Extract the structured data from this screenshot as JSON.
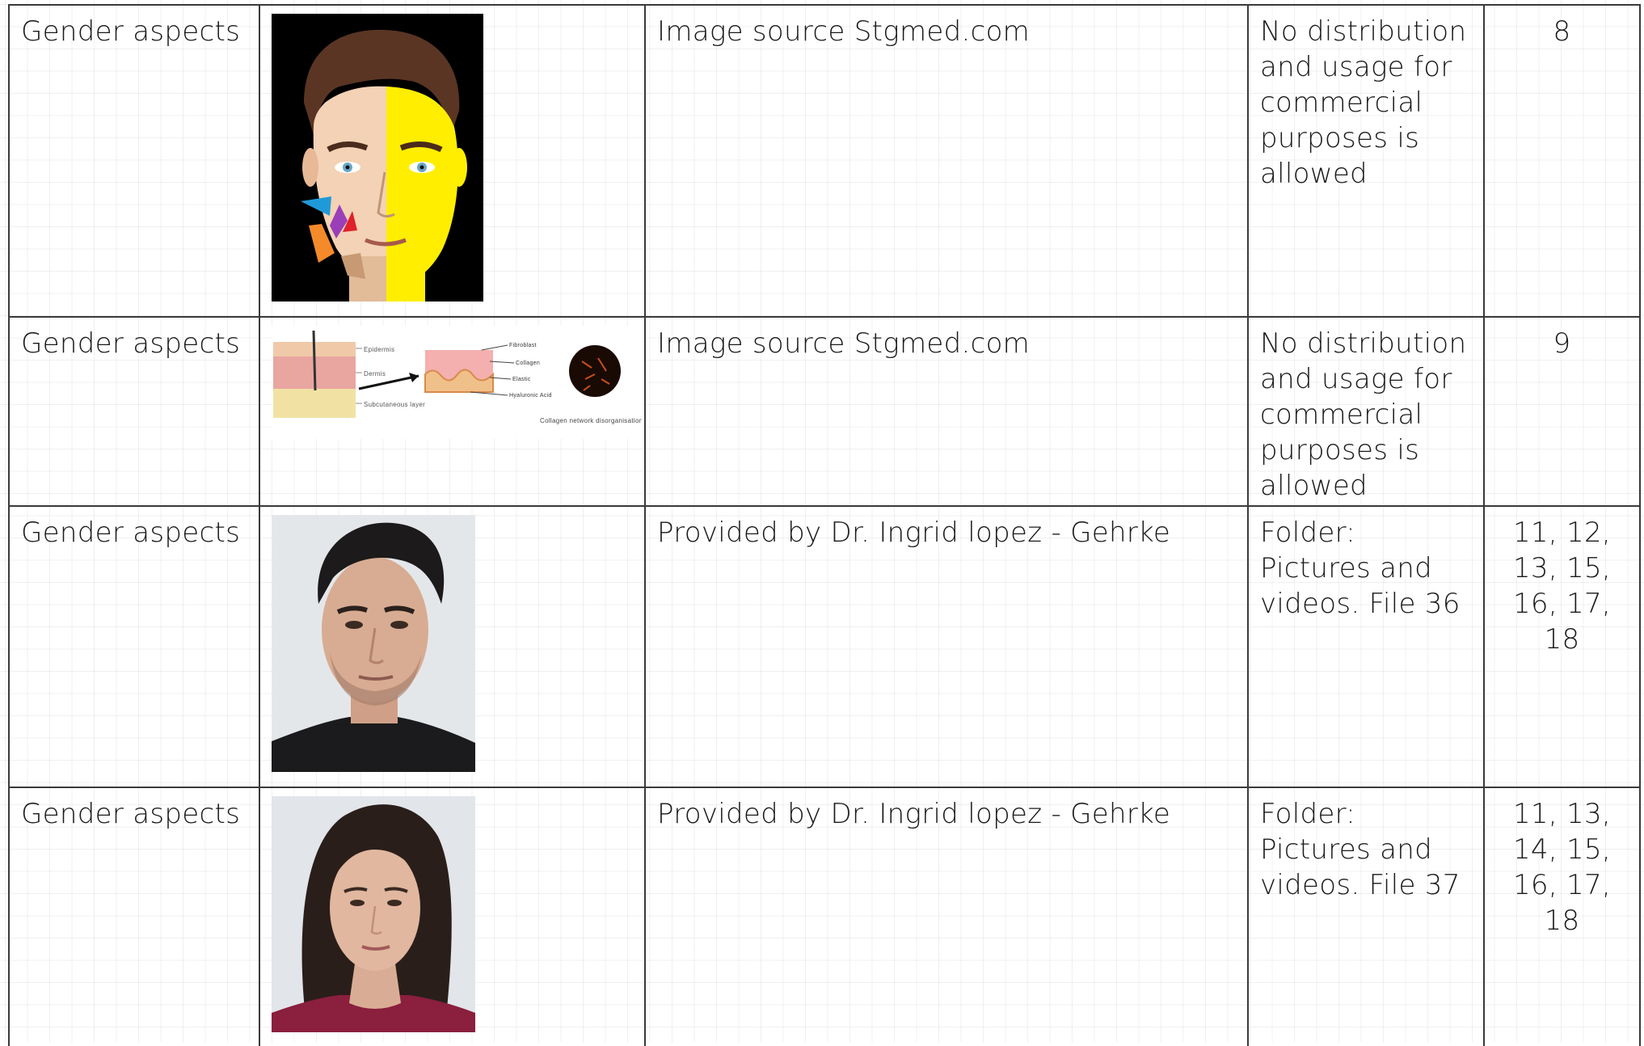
{
  "rows": [
    {
      "topic": "Gender aspects",
      "image": "illustrated-face-icon",
      "source": "Image source Stgmed.com",
      "license": "No distribution and usage for commercial purposes is allowed",
      "pages": "8"
    },
    {
      "topic": "Gender aspects",
      "image": "skin-layers-diagram-icon",
      "image_labels": [
        "Epidermis",
        "Dermis",
        "Subcutaneous layer",
        "Fibroblast",
        "Collagen",
        "Elastic",
        "Hyaluronic Acid",
        "Collagen network disorganisation"
      ],
      "source": "Image source Stgmed.com",
      "license": "No distribution and usage for commercial purposes is allowed",
      "pages": "9"
    },
    {
      "topic": "Gender aspects",
      "image": "male-portrait-photo",
      "source": "Provided by Dr. Ingrid lopez - Gehrke",
      "license": "Folder: Pictures and videos. File 36",
      "pages": "11, 12, 13, 15, 16, 17, 18"
    },
    {
      "topic": "Gender aspects",
      "image": "female-portrait-photo",
      "source": "Provided by Dr. Ingrid lopez - Gehrke",
      "license": "Folder: Pictures and videos. File 37",
      "pages": "11, 13, 14, 15, 16, 17, 18"
    }
  ],
  "colors": {
    "border": "#3a3a3a",
    "grid": "#e8e8e8",
    "face_yellow": "#ffee00",
    "face_blue": "#1f9ad9",
    "face_purple": "#9b3fb8",
    "face_red": "#e0202a",
    "face_orange": "#f58a2a",
    "female_shirt": "#8a1f3e"
  }
}
